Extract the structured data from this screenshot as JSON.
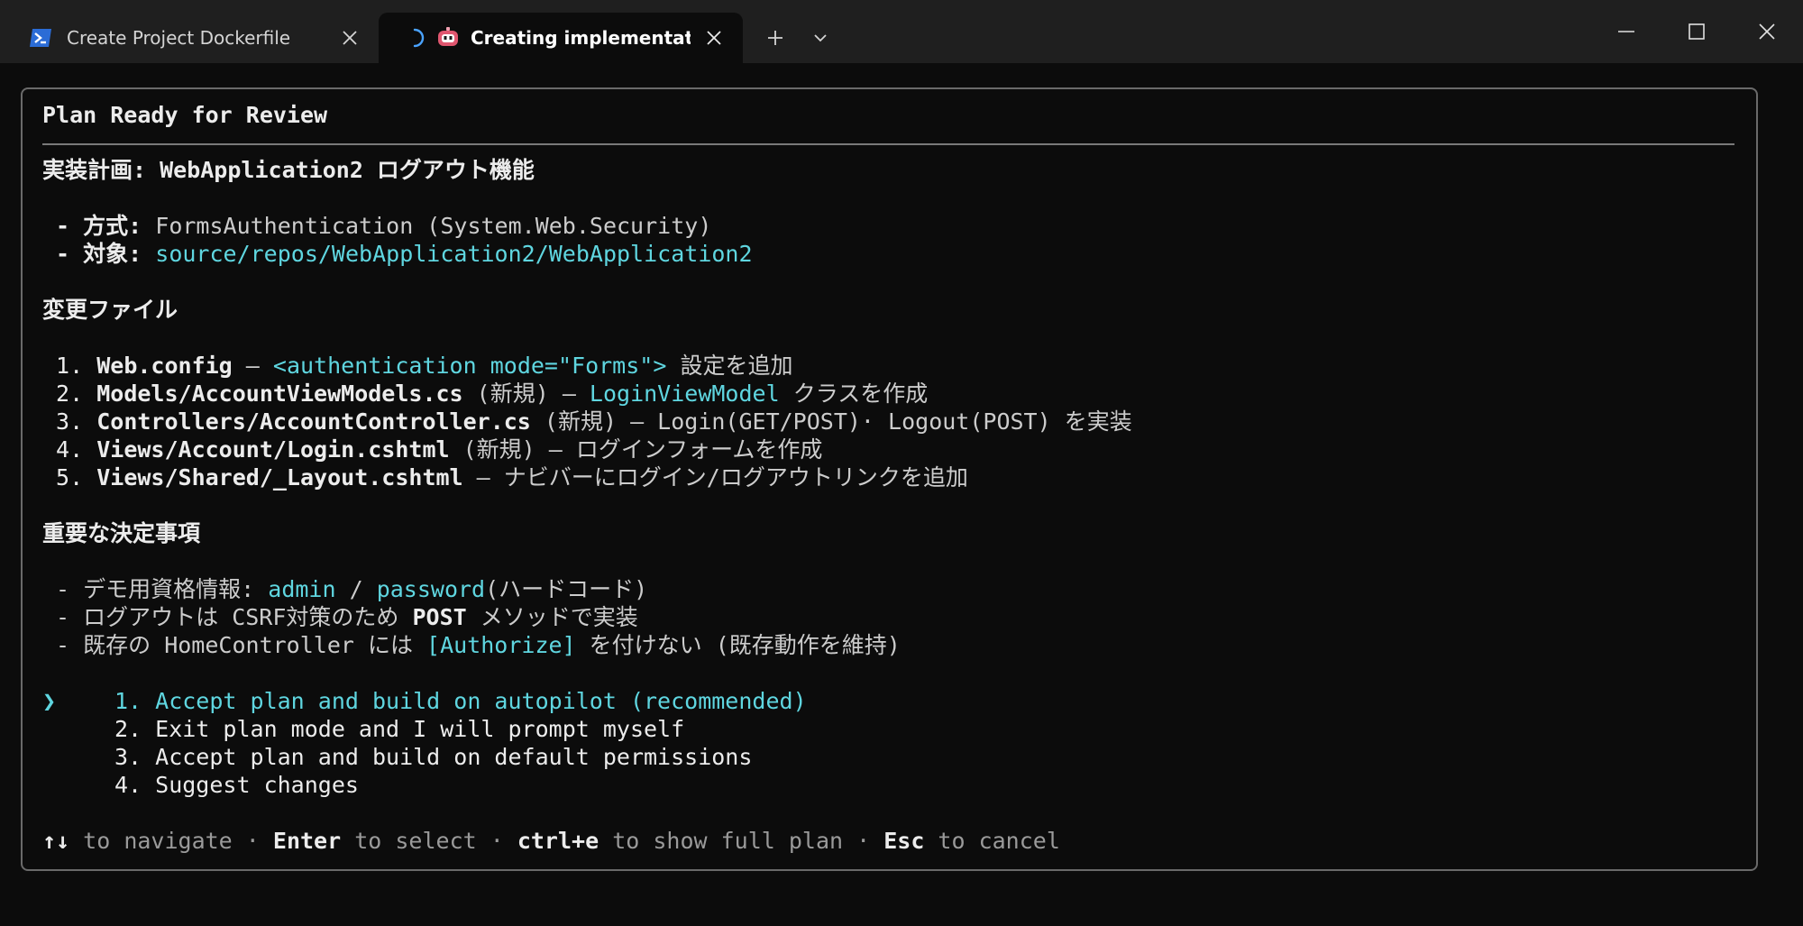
{
  "tabs": [
    {
      "title": "Create Project Dockerfile",
      "icon": "powershell-icon"
    },
    {
      "title": "Creating implementation p",
      "icon": "copilot-bot-icon",
      "loading": true
    }
  ],
  "panel": {
    "heading": "Plan Ready for Review",
    "plan_title": "実装計画: WebApplication2 ログアウト機能",
    "method": {
      "prefix": " - 方式: ",
      "value": "FormsAuthentication (System.Web.Security)"
    },
    "target": {
      "prefix": " - 対象: ",
      "value": "source/repos/WebApplication2/WebApplication2"
    },
    "files_heading": "変更ファイル",
    "files": [
      {
        "num": " 1. ",
        "path": "Web.config",
        "mid": " – ",
        "highlight": "<authentication mode=\"Forms\">",
        "rest": " 設定を追加"
      },
      {
        "num": " 2. ",
        "path": "Models/AccountViewModels.cs",
        "mid": " (新規) – ",
        "highlight": "LoginViewModel",
        "rest": " クラスを作成"
      },
      {
        "num": " 3. ",
        "path": "Controllers/AccountController.cs",
        "mid": " (新規) – Login(GET/POST)· Logout(POST) を実装",
        "highlight": "",
        "rest": ""
      },
      {
        "num": " 4. ",
        "path": "Views/Account/Login.cshtml",
        "mid": " (新規) – ログインフォームを作成",
        "highlight": "",
        "rest": ""
      },
      {
        "num": " 5. ",
        "path": "Views/Shared/_Layout.cshtml",
        "mid": " – ナビバーにログイン/ログアウトリンクを追加",
        "highlight": "",
        "rest": ""
      }
    ],
    "decisions_heading": "重要な決定事項",
    "decisions": {
      "d1_prefix": " - デモ用資格情報: ",
      "d1_user": "admin",
      "d1_sep": " / ",
      "d1_pass": "password",
      "d1_suffix": "(ハードコード)",
      "d2_prefix": " - ログアウトは CSRF対策のため ",
      "d2_bold": "POST",
      "d2_suffix": " メソッドで実装",
      "d3_prefix": " - 既存の HomeController には ",
      "d3_attr": "[Authorize]",
      "d3_suffix": " を付けない (既存動作を維持)"
    },
    "options": [
      {
        "label": "1. Accept plan and build on autopilot (recommended)",
        "selected": true
      },
      {
        "label": "2. Exit plan mode and I will prompt myself",
        "selected": false
      },
      {
        "label": "3. Accept plan and build on default permissions",
        "selected": false
      },
      {
        "label": "4. Suggest changes",
        "selected": false
      }
    ],
    "selector_glyph": "❯",
    "footer": {
      "nav_keys": "↑↓",
      "nav_text": " to navigate · ",
      "enter_key": "Enter",
      "enter_text": " to select · ",
      "ctrl_key": "ctrl+e",
      "ctrl_text": " to show full plan · ",
      "esc_key": "Esc",
      "esc_text": " to cancel"
    }
  },
  "colors": {
    "background": "#0c0c0c",
    "titlebar": "#1f1f1f",
    "accent_cyan": "#5fd6e0",
    "border": "#6a6a6a"
  }
}
